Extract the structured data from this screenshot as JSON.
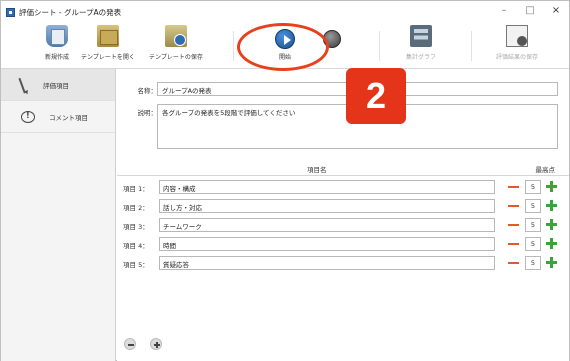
{
  "window": {
    "title": "評価シート - グループAの発表",
    "controls": [
      "–",
      "□",
      "×"
    ]
  },
  "toolbar": {
    "items": [
      {
        "label": "新規作成",
        "icon": "new-sheet-icon",
        "enabled": true
      },
      {
        "label": "テンプレートを開く",
        "icon": "open-folder-icon",
        "enabled": true
      },
      {
        "label": "テンプレートの保存",
        "icon": "save-template-icon",
        "enabled": true
      },
      {
        "label": "開始",
        "icon": "play-icon",
        "enabled": true
      },
      {
        "label": "",
        "icon": "stop-icon",
        "enabled": false
      },
      {
        "label": "集計グラフ",
        "icon": "chart-icon",
        "enabled": false
      },
      {
        "label": "評価結果の保存",
        "icon": "export-icon",
        "enabled": false
      }
    ]
  },
  "annotation": {
    "badge_number": "2",
    "color": "#e4351a"
  },
  "sidebar": {
    "items": [
      {
        "label": "評価項目",
        "icon": "pen-icon",
        "active": true
      },
      {
        "label": "コメント項目",
        "icon": "comment-icon",
        "active": false
      }
    ]
  },
  "form": {
    "name_label": "名称：",
    "name_value": "グループAの発表",
    "desc_label": "説明：",
    "desc_value": "各グループの発表を5段階で評価してください"
  },
  "items_table": {
    "header_name": "項目名",
    "header_max": "最高点",
    "rows": [
      {
        "label": "項目 1：",
        "value": "内容・構成",
        "max": "5"
      },
      {
        "label": "項目 2：",
        "value": "話し方・対応",
        "max": "5"
      },
      {
        "label": "項目 3：",
        "value": "チームワーク",
        "max": "5"
      },
      {
        "label": "項目 4：",
        "value": "時間",
        "max": "5"
      },
      {
        "label": "項目 5：",
        "value": "質疑応答",
        "max": "5"
      }
    ]
  },
  "colors": {
    "accent": "#2e6db4",
    "minus": "#e05a2c",
    "plus": "#3aa33a",
    "annotation": "#e8401c"
  }
}
